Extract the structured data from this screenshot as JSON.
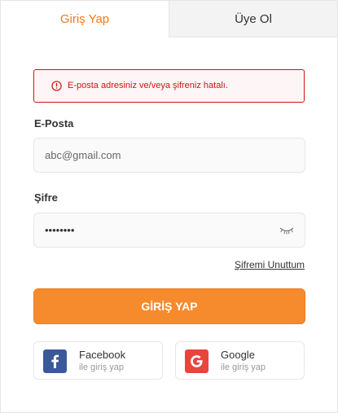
{
  "tabs": {
    "login_label": "Giriş Yap",
    "signup_label": "Üye Ol"
  },
  "alert": {
    "message": "E-posta adresiniz ve/veya şifreniz hatalı.",
    "icon": "alert-circle-icon"
  },
  "email": {
    "label": "E-Posta",
    "value": "abc@gmail.com"
  },
  "password": {
    "label": "Şifre",
    "masked_value": "••••••••",
    "toggle_icon": "eye-closed-icon"
  },
  "forgot_password_label": "Şifremi Unuttum",
  "login_button_label": "GİRİŞ YAP",
  "social": {
    "facebook": {
      "name": "Facebook",
      "sub": "ile giriş yap",
      "icon": "facebook-icon"
    },
    "google": {
      "name": "Google",
      "sub": "ile giriş yap",
      "icon": "google-icon"
    }
  },
  "colors": {
    "accent": "#f27a1a",
    "button": "#f68b2d",
    "error": "#d21313",
    "facebook": "#3b5998",
    "google": "#e8453c"
  }
}
